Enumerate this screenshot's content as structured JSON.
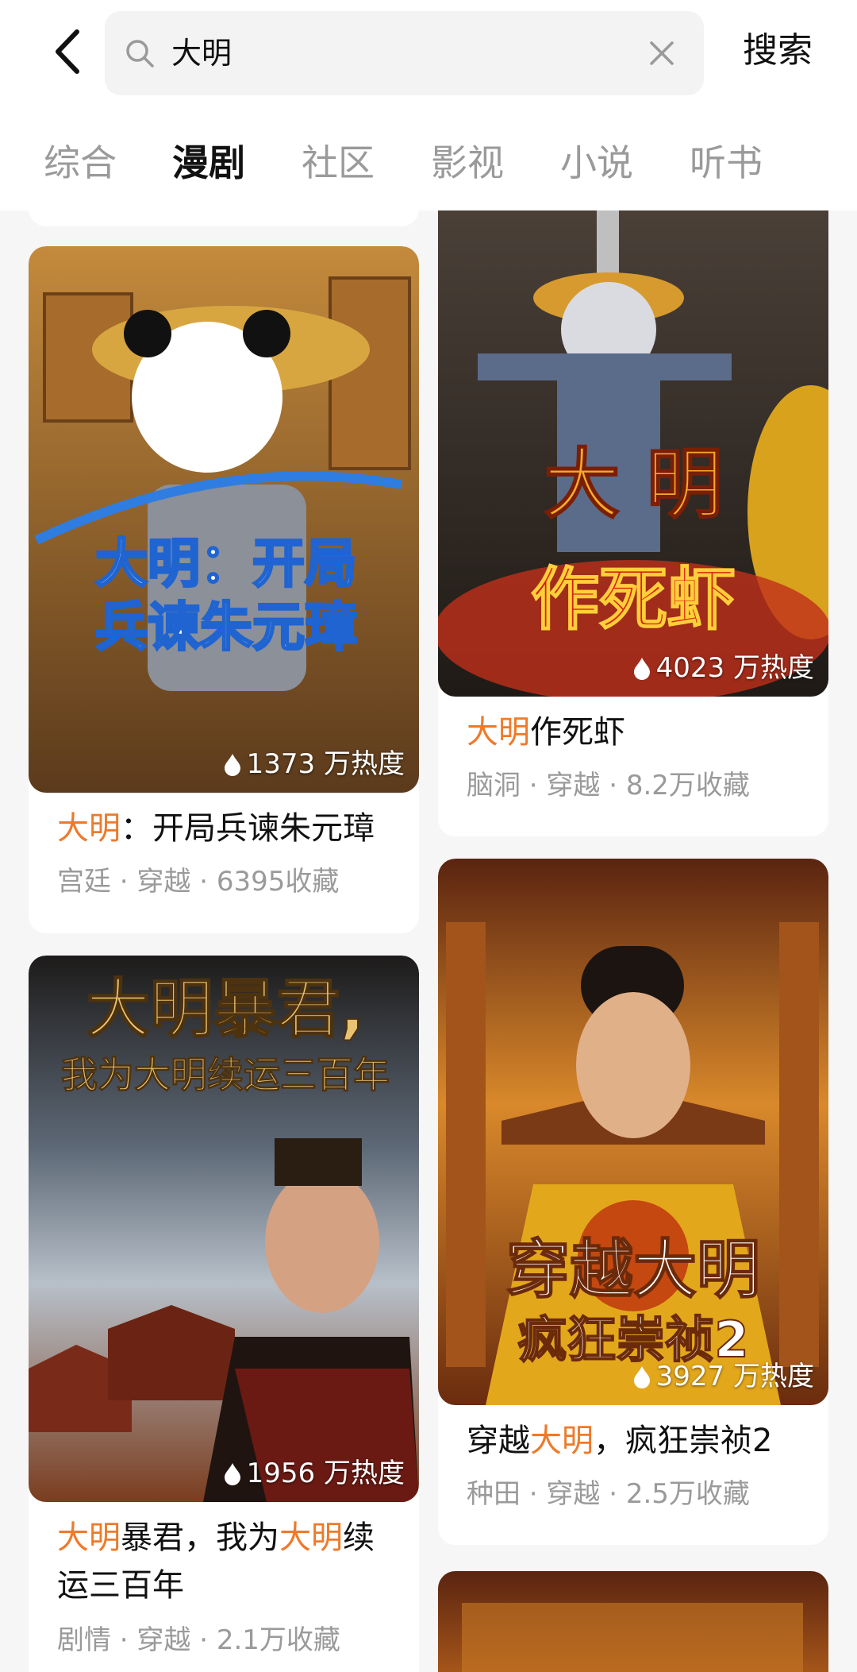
{
  "search": {
    "query": "大明",
    "button_label": "搜索"
  },
  "tabs": [
    {
      "label": "综合"
    },
    {
      "label": "漫剧"
    },
    {
      "label": "社区"
    },
    {
      "label": "影视"
    },
    {
      "label": "小说"
    },
    {
      "label": "听书"
    }
  ],
  "active_tab": "漫剧",
  "colors": {
    "highlight": "#ee7a2a",
    "meta": "#9a9a9a"
  },
  "cards": [
    {
      "cover_text_line1": "大明：开局",
      "cover_text_line2": "兵谏朱元璋",
      "heat": "1373 万热度",
      "title_hl": "大明",
      "title_rest": "：开局兵谏朱元璋",
      "meta": "宫廷 · 穿越 · 6395收藏"
    },
    {
      "cover_text_line1": "大 明",
      "cover_text_line2": "作死虾",
      "heat": "4023 万热度",
      "title_hl": "大明",
      "title_rest": "作死虾",
      "meta": "脑洞 · 穿越 · 8.2万收藏"
    },
    {
      "cover_text_line1": "大明暴君,",
      "cover_text_line2": "我为大明续运三百年",
      "heat": "1956 万热度",
      "title_hl1": "大明",
      "title_mid": "暴君，我为",
      "title_hl2": "大明",
      "title_rest": "续运三百年",
      "meta": "剧情 · 穿越 · 2.1万收藏"
    },
    {
      "cover_text_line1": "穿越大明",
      "cover_text_line2": "疯狂崇祯2",
      "heat": "3927 万热度",
      "title_pre": "穿越",
      "title_hl": "大明",
      "title_rest": "，疯狂崇祯2",
      "meta": "种田 · 穿越 · 2.5万收藏"
    }
  ]
}
